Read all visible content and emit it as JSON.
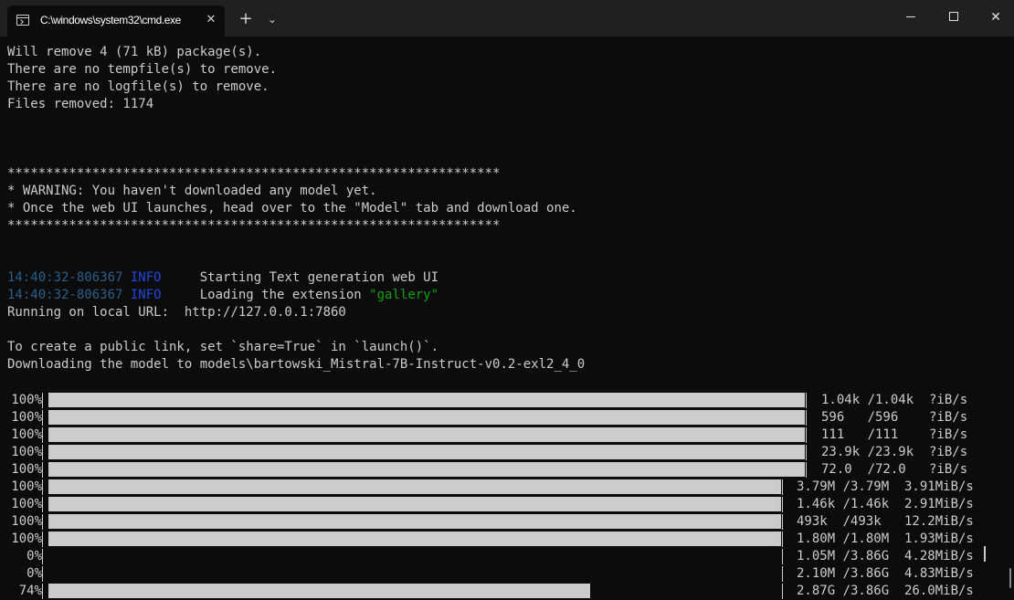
{
  "window": {
    "tab_title": "C:\\windows\\system32\\cmd.exe",
    "tab_close": "✕",
    "new_tab": "+",
    "dropdown": "⌄",
    "maximize": "",
    "close": "✕"
  },
  "terminal": {
    "lines": [
      [
        {
          "t": "Will remove 4 (71 kB) package(s)."
        }
      ],
      [
        {
          "t": "There are no tempfile(s) to remove."
        }
      ],
      [
        {
          "t": "There are no logfile(s) to remove."
        }
      ],
      [
        {
          "t": "Files removed: 1174"
        }
      ],
      [],
      [],
      [],
      [
        {
          "t": "****************************************************************"
        }
      ],
      [
        {
          "t": "* WARNING: You haven't downloaded any model yet."
        }
      ],
      [
        {
          "t": "* Once the web UI launches, head over to the \"Model\" tab and download one."
        }
      ],
      [
        {
          "t": "****************************************************************"
        }
      ],
      [],
      [],
      [
        {
          "t": "14:40:32-806367",
          "c": "ts"
        },
        {
          "t": " "
        },
        {
          "t": "INFO",
          "c": "lvl"
        },
        {
          "t": "     Starting Text generation web UI"
        }
      ],
      [
        {
          "t": "14:40:32-806367",
          "c": "ts"
        },
        {
          "t": " "
        },
        {
          "t": "INFO",
          "c": "lvl"
        },
        {
          "t": "     Loading the extension "
        },
        {
          "t": "\"gallery\"",
          "c": "grn"
        }
      ],
      [
        {
          "t": "Running on local URL:  http://127.0.0.1:7860"
        }
      ],
      [],
      [
        {
          "t": "To create a public link, set `share=True` in `launch()`."
        }
      ],
      [
        {
          "t": "Downloading the model to models\\bartowski_Mistral-7B-Instruct-v0.2-exl2_4_0"
        }
      ]
    ],
    "progress": [
      {
        "pct": "100%",
        "fraction": 1.0,
        "info": "1.04k /1.04k  ?iB/s"
      },
      {
        "pct": "100%",
        "fraction": 1.0,
        "info": "596   /596    ?iB/s"
      },
      {
        "pct": "100%",
        "fraction": 1.0,
        "info": "111   /111    ?iB/s"
      },
      {
        "pct": "100%",
        "fraction": 1.0,
        "info": "23.9k /23.9k  ?iB/s"
      },
      {
        "pct": "100%",
        "fraction": 1.0,
        "info": "72.0  /72.0   ?iB/s"
      },
      {
        "pct": "100%",
        "fraction": 1.0,
        "info": "3.79M /3.79M  3.91MiB/s"
      },
      {
        "pct": "100%",
        "fraction": 1.0,
        "info": "1.46k /1.46k  2.91MiB/s"
      },
      {
        "pct": "100%",
        "fraction": 1.0,
        "info": "493k  /493k   12.2MiB/s"
      },
      {
        "pct": "100%",
        "fraction": 1.0,
        "info": "1.80M /1.80M  1.93MiB/s"
      },
      {
        "pct": "0%",
        "fraction": 0.0,
        "info": "1.05M /3.86G  4.28MiB/s"
      },
      {
        "pct": "0%",
        "fraction": 0.0,
        "info": "2.10M /3.86G  4.83MiB/s"
      },
      {
        "pct": "74%",
        "fraction": 0.74,
        "info": "2.87G /3.86G  26.0MiB/s"
      }
    ]
  },
  "colors": {
    "background": "#0c0c0c",
    "text": "#cccccc",
    "timestamp": "#2a5f8a",
    "level": "#2248dc",
    "string": "#13a10e"
  }
}
